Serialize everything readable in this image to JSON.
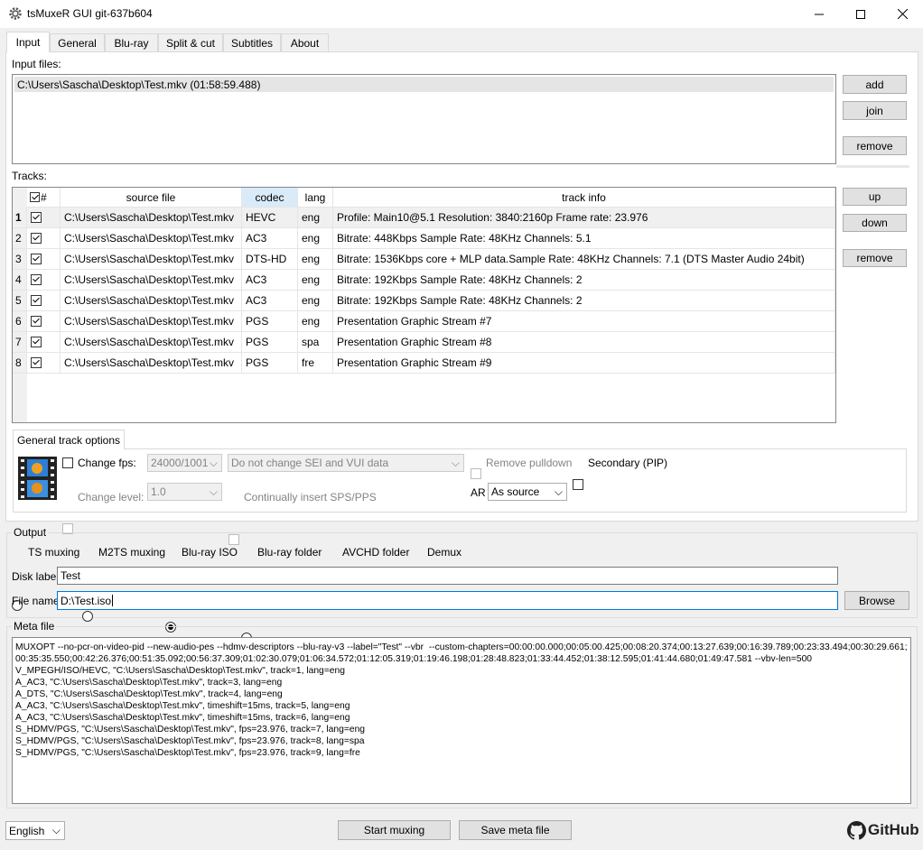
{
  "window": {
    "title": "tsMuxeR GUI git-637b604"
  },
  "tabs": [
    "Input",
    "General",
    "Blu-ray",
    "Split & cut",
    "Subtitles",
    "About"
  ],
  "input": {
    "label": "Input files:",
    "files": [
      "C:\\Users\\Sascha\\Desktop\\Test.mkv (01:58:59.488)"
    ],
    "buttons": {
      "add": "add",
      "join": "join",
      "remove": "remove"
    }
  },
  "tracks": {
    "label": "Tracks:",
    "headers": [
      "#",
      "source file",
      "codec",
      "lang",
      "track info"
    ],
    "rows": [
      {
        "n": "1",
        "file": "C:\\Users\\Sascha\\Desktop\\Test.mkv",
        "codec": "HEVC",
        "lang": "eng",
        "info": "Profile: Main10@5.1 Resolution: 3840:2160p  Frame rate: 23.976"
      },
      {
        "n": "2",
        "file": "C:\\Users\\Sascha\\Desktop\\Test.mkv",
        "codec": "AC3",
        "lang": "eng",
        "info": "Bitrate: 448Kbps Sample Rate: 48KHz Channels: 5.1"
      },
      {
        "n": "3",
        "file": "C:\\Users\\Sascha\\Desktop\\Test.mkv",
        "codec": "DTS-HD",
        "lang": "eng",
        "info": "Bitrate: 1536Kbps  core + MLP data.Sample Rate: 48KHz  Channels: 7.1 (DTS Master Audio 24bit)"
      },
      {
        "n": "4",
        "file": "C:\\Users\\Sascha\\Desktop\\Test.mkv",
        "codec": "AC3",
        "lang": "eng",
        "info": "Bitrate: 192Kbps Sample Rate: 48KHz Channels: 2"
      },
      {
        "n": "5",
        "file": "C:\\Users\\Sascha\\Desktop\\Test.mkv",
        "codec": "AC3",
        "lang": "eng",
        "info": "Bitrate: 192Kbps Sample Rate: 48KHz Channels: 2"
      },
      {
        "n": "6",
        "file": "C:\\Users\\Sascha\\Desktop\\Test.mkv",
        "codec": "PGS",
        "lang": "eng",
        "info": "Presentation Graphic Stream #7"
      },
      {
        "n": "7",
        "file": "C:\\Users\\Sascha\\Desktop\\Test.mkv",
        "codec": "PGS",
        "lang": "spa",
        "info": "Presentation Graphic Stream #8"
      },
      {
        "n": "8",
        "file": "C:\\Users\\Sascha\\Desktop\\Test.mkv",
        "codec": "PGS",
        "lang": "fre",
        "info": "Presentation Graphic Stream #9"
      }
    ],
    "buttons": {
      "up": "up",
      "down": "down",
      "remove": "remove"
    }
  },
  "track_options": {
    "tab": "General track options",
    "change_fps": "Change fps:",
    "fps_value": "24000/1001",
    "sei_value": "Do not change SEI and VUI data",
    "remove_pulldown": "Remove pulldown",
    "secondary": "Secondary (PIP)",
    "change_level": "Change level:",
    "level_value": "1.0",
    "insert_sps": "Continually insert SPS/PPS",
    "ar_label": "AR",
    "ar_value": "As source"
  },
  "output": {
    "label": "Output",
    "modes": [
      "TS muxing",
      "M2TS muxing",
      "Blu-ray ISO",
      "Blu-ray folder",
      "AVCHD folder",
      "Demux"
    ],
    "selected": "Blu-ray ISO",
    "disk_label_label": "Disk label",
    "disk_label_value": "Test",
    "file_name_label": "File name",
    "file_name_value": "D:\\Test.iso",
    "browse": "Browse"
  },
  "meta": {
    "label": "Meta file",
    "text": "MUXOPT --no-pcr-on-video-pid --new-audio-pes --hdmv-descriptors --blu-ray-v3 --label=\"Test\" --vbr  --custom-chapters=00:00:00.000;00:05:00.425;00:08:20.374;00:13:27.639;00:16:39.789;00:23:33.494;00:30:29.661;00:35:35.550;00:42:26.376;00:51:35.092;00:56:37.309;01:02:30.079;01:06:34.572;01:12:05.319;01:19:46.198;01:28:48.823;01:33:44.452;01:38:12.595;01:41:44.680;01:49:47.581 --vbv-len=500\nV_MPEGH/ISO/HEVC, \"C:\\Users\\Sascha\\Desktop\\Test.mkv\", track=1, lang=eng\nA_AC3, \"C:\\Users\\Sascha\\Desktop\\Test.mkv\", track=3, lang=eng\nA_DTS, \"C:\\Users\\Sascha\\Desktop\\Test.mkv\", track=4, lang=eng\nA_AC3, \"C:\\Users\\Sascha\\Desktop\\Test.mkv\", timeshift=15ms, track=5, lang=eng\nA_AC3, \"C:\\Users\\Sascha\\Desktop\\Test.mkv\", timeshift=15ms, track=6, lang=eng\nS_HDMV/PGS, \"C:\\Users\\Sascha\\Desktop\\Test.mkv\", fps=23.976, track=7, lang=eng\nS_HDMV/PGS, \"C:\\Users\\Sascha\\Desktop\\Test.mkv\", fps=23.976, track=8, lang=spa\nS_HDMV/PGS, \"C:\\Users\\Sascha\\Desktop\\Test.mkv\", fps=23.976, track=9, lang=fre"
  },
  "footer": {
    "language": "English",
    "start": "Start muxing",
    "save": "Save meta file",
    "github": "GitHub"
  }
}
